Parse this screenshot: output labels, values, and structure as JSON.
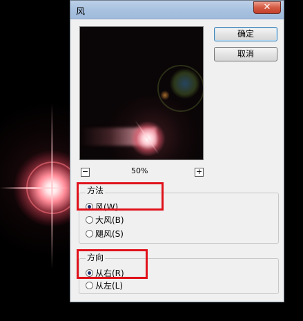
{
  "dialog": {
    "title": "风",
    "close_glyph": "✕",
    "zoom_level": "50%",
    "zoom_out_glyph": "−",
    "zoom_in_glyph": "+",
    "ok_label": "确定",
    "cancel_label": "取消"
  },
  "method": {
    "legend": "方法",
    "options": [
      {
        "label": "风(W)",
        "checked": true
      },
      {
        "label": "大风(B)",
        "checked": false
      },
      {
        "label": "飓风(S)",
        "checked": false
      }
    ]
  },
  "direction": {
    "legend": "方向",
    "options": [
      {
        "label": "从右(R)",
        "checked": true
      },
      {
        "label": "从左(L)",
        "checked": false
      }
    ]
  },
  "colors": {
    "highlight_box": "#e0101a",
    "title_bar": "#a9c2e0",
    "dialog_bg": "#f0f0f0"
  },
  "icons": [
    "close-icon",
    "zoom-out-icon",
    "zoom-in-icon"
  ]
}
